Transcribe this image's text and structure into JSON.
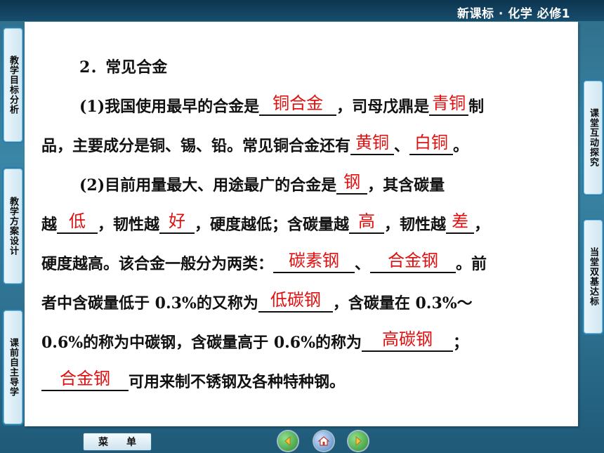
{
  "header": {
    "title": "新课标 · 化学  必修1"
  },
  "left_tabs": [
    {
      "label": "教学目标分析"
    },
    {
      "label": "教学方案设计"
    },
    {
      "label": "课前自主导学"
    }
  ],
  "right_tabs": [
    {
      "label": "课堂互动探究"
    },
    {
      "label": "当堂双基达标"
    }
  ],
  "content": {
    "heading": "2．常见合金",
    "l1": {
      "t1": "(1)我国使用最早的合金是",
      "a1": "铜合金",
      "t2": "，司母戊鼎是",
      "a2": "青铜",
      "t3": "制"
    },
    "l2": {
      "t1": "品，主要成分是铜、锡、铅。常见铜合金还有",
      "a1": "黄铜",
      "t2": "、",
      "a2": "白铜",
      "t3": "。"
    },
    "l3": {
      "t1": "(2)目前用量最大、用途最广的合金是",
      "a1": "钢",
      "t2": "，其含碳量"
    },
    "l4": {
      "t1": "越",
      "a1": "低",
      "t2": "，韧性越",
      "a2": "好",
      "t3": "，硬度越低；含碳量越",
      "a3": "高",
      "t4": "，韧性越",
      "a4": "差",
      "t5": "，"
    },
    "l5": {
      "t1": "硬度越高。该合金一般分为两类：",
      "a1": "碳素钢",
      "t2": "、",
      "a2": "合金钢",
      "t3": "。前"
    },
    "l6": {
      "t1": "者中含碳量低于 0.3%的又称为",
      "a1": "低碳钢",
      "t2": "，含碳量在 0.3%～"
    },
    "l7": {
      "t1": "0.6%的称为中碳钢，含碳量高于 0.6%的称为",
      "a1": "高碳钢",
      "t2": "；"
    },
    "l8": {
      "a1": "合金钢",
      "t1": "可用来制不锈钢及各种特种钢。"
    }
  },
  "footer": {
    "menu_label": "菜单",
    "nav": [
      {
        "icon": "back-icon",
        "color": "#3aa03a"
      },
      {
        "icon": "home-icon",
        "color": "#4f86c6"
      },
      {
        "icon": "forward-icon",
        "color": "#3aa03a"
      }
    ]
  }
}
